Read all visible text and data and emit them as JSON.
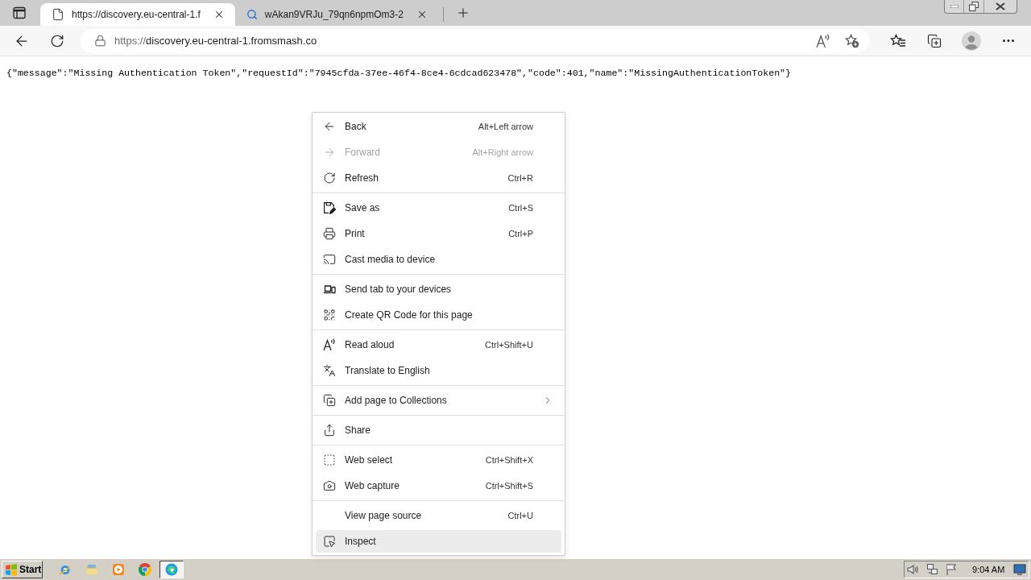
{
  "browser": {
    "tabs": [
      {
        "title": "https://discovery.eu-central-1.f",
        "selected": true
      },
      {
        "title": "wAkan9VRJu_79qn6npmOm3-2",
        "selected": false
      }
    ],
    "address_bar": {
      "scheme": "https://",
      "host": "discovery.eu-central-1.fromsmash.co"
    }
  },
  "page": {
    "text": "{\"message\":\"Missing Authentication Token\",\"requestId\":\"7945cfda-37ee-46f4-8ce4-6cdcad623478\",\"code\":401,\"name\":\"MissingAuthenticationToken\"}"
  },
  "context_menu": {
    "sections": [
      {
        "items": [
          {
            "label": "Back",
            "shortcut": "Alt+Left arrow",
            "disabled": false,
            "selected": false,
            "submenu": false
          },
          {
            "label": "Forward",
            "shortcut": "Alt+Right arrow",
            "disabled": true,
            "selected": false,
            "submenu": false
          },
          {
            "label": "Refresh",
            "shortcut": "Ctrl+R",
            "disabled": false,
            "selected": false,
            "submenu": false
          }
        ]
      },
      {
        "items": [
          {
            "label": "Save as",
            "shortcut": "Ctrl+S",
            "disabled": false,
            "selected": false,
            "submenu": false
          },
          {
            "label": "Print",
            "shortcut": "Ctrl+P",
            "disabled": false,
            "selected": false,
            "submenu": false
          },
          {
            "label": "Cast media to device",
            "disabled": false,
            "selected": false,
            "submenu": false
          }
        ]
      },
      {
        "items": [
          {
            "label": "Send tab to your devices",
            "disabled": false,
            "selected": false,
            "submenu": false
          },
          {
            "label": "Create QR Code for this page",
            "disabled": false,
            "selected": false,
            "submenu": false
          }
        ]
      },
      {
        "items": [
          {
            "label": "Read aloud",
            "shortcut": "Ctrl+Shift+U",
            "disabled": false,
            "selected": false,
            "submenu": false
          },
          {
            "label": "Translate to English",
            "disabled": false,
            "selected": false,
            "submenu": false
          }
        ]
      },
      {
        "items": [
          {
            "label": "Add page to Collections",
            "disabled": false,
            "selected": false,
            "submenu": true
          }
        ]
      },
      {
        "items": [
          {
            "label": "Share",
            "disabled": false,
            "selected": false,
            "submenu": false
          }
        ]
      },
      {
        "items": [
          {
            "label": "Web select",
            "shortcut": "Ctrl+Shift+X",
            "disabled": false,
            "selected": false,
            "submenu": false
          },
          {
            "label": "Web capture",
            "shortcut": "Ctrl+Shift+S",
            "disabled": false,
            "selected": false,
            "submenu": false
          }
        ]
      },
      {
        "items": [
          {
            "label": "View page source",
            "shortcut": "Ctrl+U",
            "disabled": false,
            "selected": false,
            "submenu": false
          },
          {
            "label": "Inspect",
            "disabled": false,
            "selected": true,
            "submenu": false
          }
        ]
      }
    ]
  },
  "taskbar": {
    "start": "Start",
    "apps": [
      {
        "selected": false
      },
      {
        "selected": false
      },
      {
        "selected": false
      },
      {
        "selected": false
      },
      {
        "selected": true
      }
    ],
    "clock": "9:04 AM"
  }
}
